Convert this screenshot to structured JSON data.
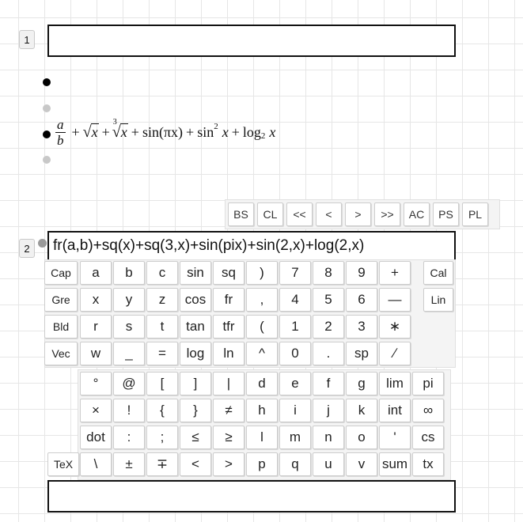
{
  "rows": [
    {
      "number": "1",
      "value": ""
    },
    {
      "number": "2",
      "value": "fr(a,b)+sq(x)+sq(3,x)+sin(pix)+sin(2,x)+log(2,x)"
    }
  ],
  "bottom_input": {
    "value": ""
  },
  "formula": {
    "frac_num": "a",
    "frac_den": "b",
    "plus": "+",
    "sqrt_arg": "x",
    "cbrt_index": "3",
    "cbrt_arg": "x",
    "sin1": "sin(πx)",
    "sin2_fn": "sin",
    "sin2_exp": "2",
    "sin2_arg": "x",
    "log_fn": "log",
    "log_base": "2",
    "log_arg": "x",
    "sqrt_symbol": "√"
  },
  "nav_keys": [
    "BS",
    "CL",
    "<<",
    "<",
    ">",
    ">>",
    "AC",
    "PS",
    "PL"
  ],
  "left_keys": [
    "Cap",
    "Gre",
    "Bld",
    "Vec"
  ],
  "right_keys": [
    "Cal",
    "Lin"
  ],
  "tex_key": "TeX",
  "main_keys": [
    [
      "a",
      "b",
      "c",
      "sin",
      "sq",
      ")",
      "7",
      "8",
      "9",
      "+"
    ],
    [
      "x",
      "y",
      "z",
      "cos",
      "fr",
      ",",
      "4",
      "5",
      "6",
      "—"
    ],
    [
      "r",
      "s",
      "t",
      "tan",
      "tfr",
      "(",
      "1",
      "2",
      "3",
      "∗"
    ],
    [
      "w",
      "_",
      "=",
      "log",
      "ln",
      "^",
      "0",
      ".",
      "sp",
      "∕"
    ]
  ],
  "symbol_keys": [
    [
      "°",
      "@",
      "[",
      "]",
      "|",
      "d",
      "e",
      "f",
      "g",
      "lim",
      "pi"
    ],
    [
      "×",
      "!",
      "{",
      "}",
      "≠",
      "h",
      "i",
      "j",
      "k",
      "int",
      "∞"
    ],
    [
      "dot",
      ":",
      ";",
      "≤",
      "≥",
      "l",
      "m",
      "n",
      "o",
      "'",
      "cs"
    ],
    [
      "\\",
      "±",
      "∓",
      "<",
      ">",
      "p",
      "q",
      "u",
      "v",
      "sum",
      "tx"
    ]
  ]
}
